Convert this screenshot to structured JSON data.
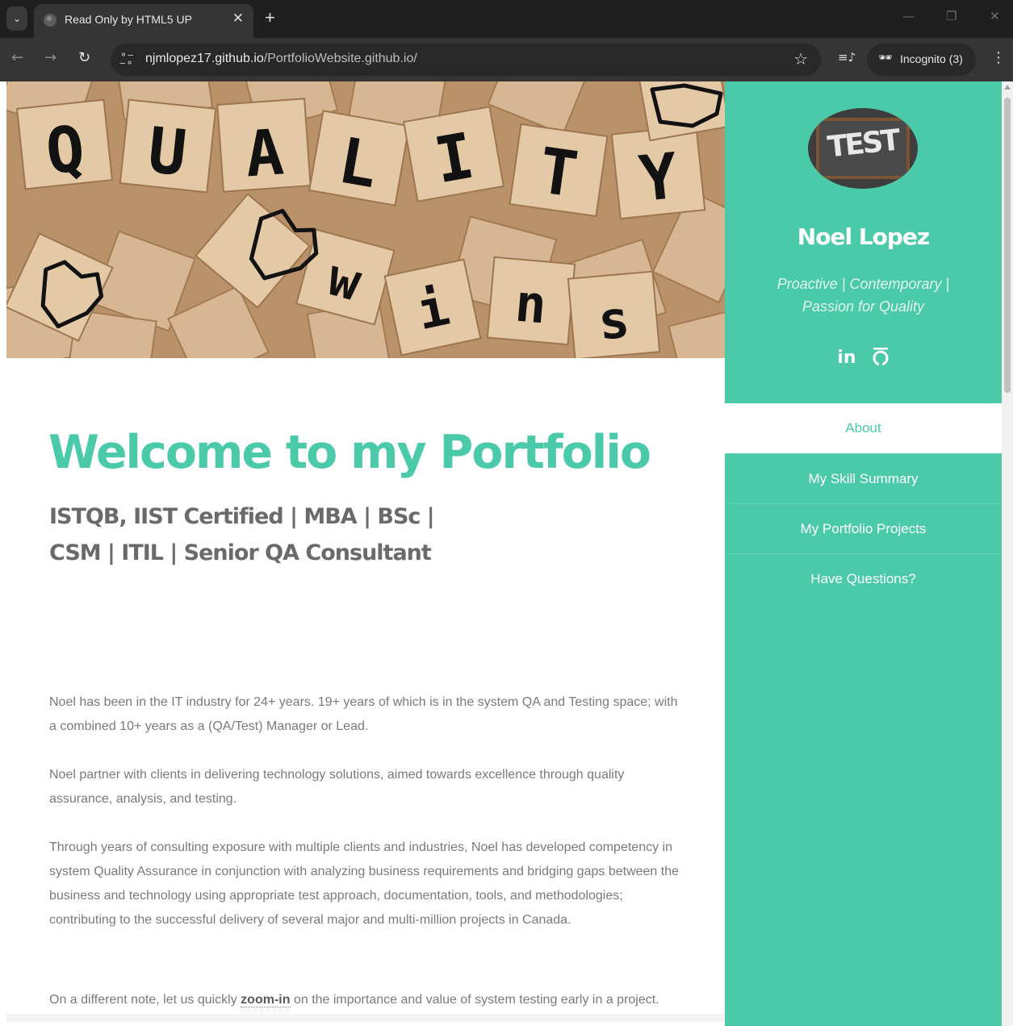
{
  "browser": {
    "tab_title": "Read Only by HTML5 UP",
    "tab_close": "✕",
    "new_tab": "+",
    "url_host": "njmlopez17.github.io",
    "url_path": "/PortfolioWebsite.github.io/",
    "incognito_label": "Incognito (3)",
    "icons": [
      "tab-search-icon",
      "favicon-icon",
      "back-icon",
      "forward-icon",
      "reload-icon",
      "site-info-icon",
      "bookmark-star-icon",
      "media-control-icon",
      "incognito-icon",
      "kebab-menu-icon",
      "minimize-icon",
      "restore-icon",
      "close-window-icon"
    ]
  },
  "banner": {
    "letters_top": [
      "Q",
      "U",
      "A",
      "L",
      "I",
      "T",
      "Y"
    ],
    "letters_bottom": [
      "w",
      "i",
      "n",
      "s"
    ]
  },
  "sidebar": {
    "name": "Noel Lopez",
    "avatar_text": "TEST",
    "tagline": "Proactive | Contemporary | Passion for Quality",
    "social_linkedin": "in",
    "nav": [
      {
        "label": "About",
        "active": true
      },
      {
        "label": "My Skill Summary",
        "active": false
      },
      {
        "label": "My Portfolio Projects",
        "active": false
      },
      {
        "label": "Have Questions?",
        "active": false
      }
    ]
  },
  "main": {
    "heading": "Welcome to my Portfolio",
    "subtitle_line1": "ISTQB, IIST Certified | MBA | BSc |",
    "subtitle_line2": "CSM | ITIL | Senior QA Consultant",
    "p1": "Noel has been in the IT industry for 24+ years. 19+ years of which is in the system QA and Testing space; with a combined 10+ years as a (QA/Test) Manager or Lead.",
    "p2": "Noel partner with clients in delivering technology solutions, aimed towards excellence through quality assurance, analysis, and testing.",
    "p3": "Through years of consulting exposure with multiple clients and industries, Noel has developed competency in system Quality Assurance in conjunction with analyzing business requirements and bridging gaps between the business and technology using appropriate test approach, documentation, tools, and methodologies; contributing to the successful delivery of several major and multi-million projects in Canada.",
    "p4_before": "On a different note, let us quickly ",
    "p4_link": "zoom-in",
    "p4_after": " on the importance and value of system testing early in a project."
  },
  "colors": {
    "accent": "#4acaa8",
    "heading_text": "#6a6a6a",
    "body_text": "#7a7a7a",
    "chrome_dark": "#1f1f1f",
    "chrome_toolbar": "#353535"
  }
}
